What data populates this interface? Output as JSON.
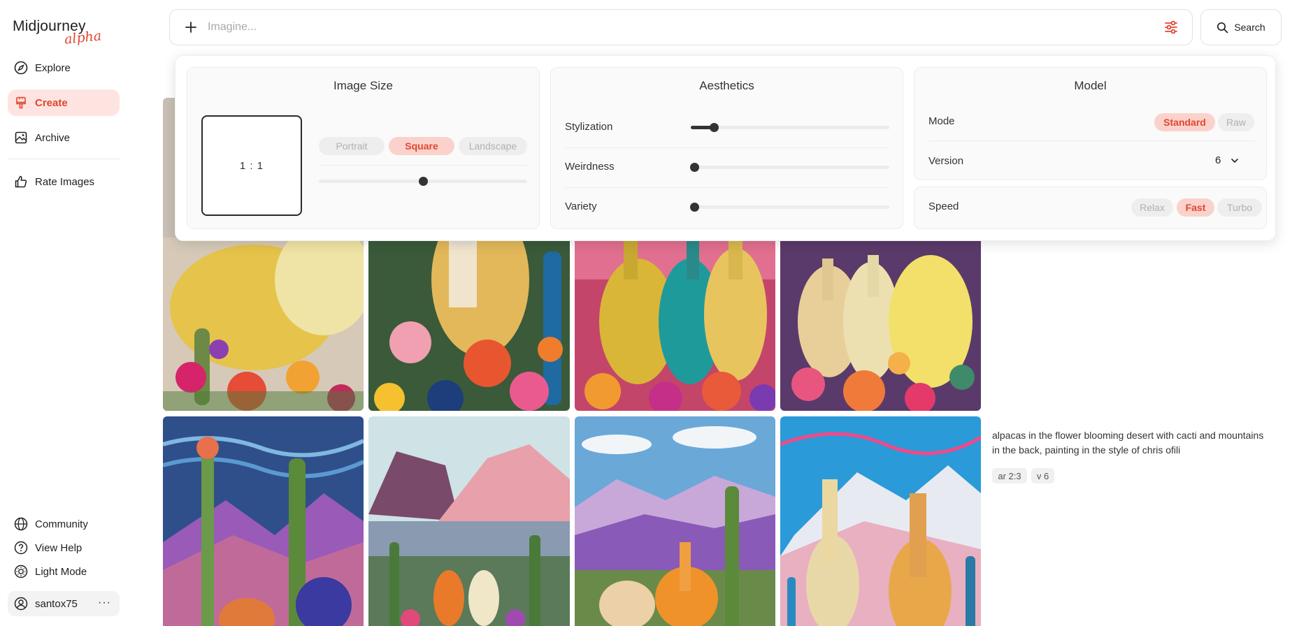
{
  "app": {
    "brand": "Midjourney",
    "badge": "alpha"
  },
  "sidebar": {
    "items": [
      {
        "label": "Explore",
        "icon": "compass-icon"
      },
      {
        "label": "Create",
        "icon": "brush-icon",
        "active": true
      },
      {
        "label": "Archive",
        "icon": "image-icon"
      },
      {
        "label": "Rate Images",
        "icon": "thumbs-up-icon"
      }
    ],
    "footer": [
      {
        "label": "Community",
        "icon": "globe-icon"
      },
      {
        "label": "View Help",
        "icon": "help-icon"
      },
      {
        "label": "Light Mode",
        "icon": "sun-icon"
      }
    ],
    "user": {
      "name": "santox75",
      "more": "···"
    }
  },
  "prompt": {
    "placeholder": "Imagine...",
    "value": ""
  },
  "search": {
    "label": "Search"
  },
  "settings": {
    "image_size": {
      "title": "Image Size",
      "ratio": "1 : 1",
      "options": [
        "Portrait",
        "Square",
        "Landscape"
      ],
      "selected": "Square",
      "slider": 0.5
    },
    "aesthetics": {
      "title": "Aesthetics",
      "rows": [
        {
          "label": "Stylization",
          "value": 0.1
        },
        {
          "label": "Weirdness",
          "value": 0.0
        },
        {
          "label": "Variety",
          "value": 0.0
        }
      ]
    },
    "model": {
      "title": "Model",
      "mode_label": "Mode",
      "modes": [
        "Standard",
        "Raw"
      ],
      "mode_selected": "Standard",
      "version_label": "Version",
      "version": "6"
    },
    "speed": {
      "label": "Speed",
      "options": [
        "Relax",
        "Fast",
        "Turbo"
      ],
      "selected": "Fast"
    }
  },
  "job": {
    "prompt": "alpacas in the flower blooming desert with cacti and mountains in the back, painting in the style of chris ofili",
    "tags": [
      "ar 2:3",
      "v 6"
    ]
  },
  "colors": {
    "accent": "#e2452f",
    "accent_bg": "#fde4e0"
  }
}
